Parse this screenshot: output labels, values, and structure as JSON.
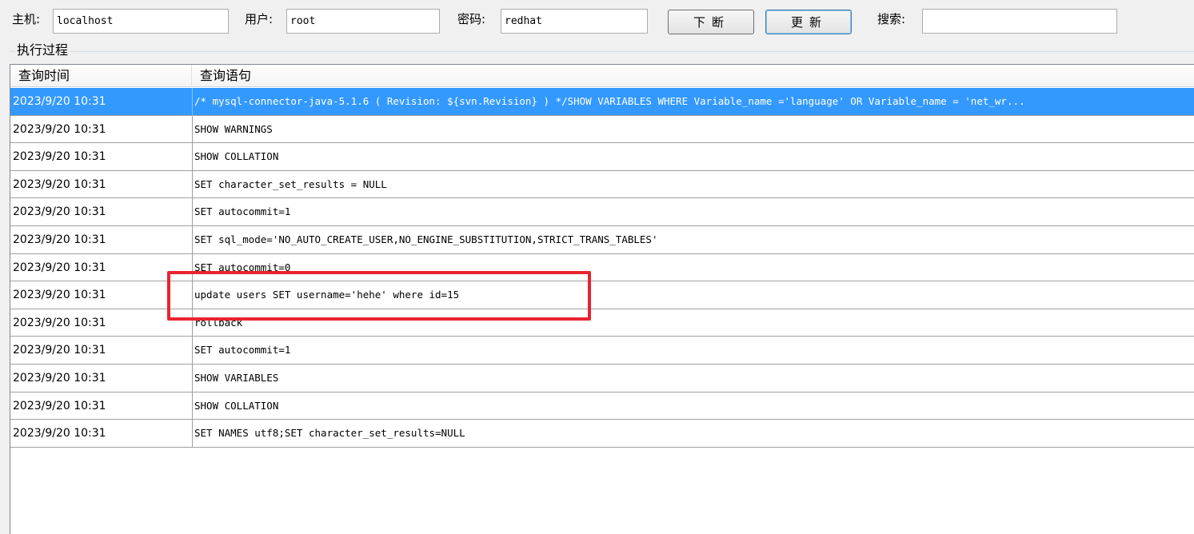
{
  "toolbar": {
    "host_label": "主机:",
    "host_value": "localhost",
    "user_label": "用户:",
    "user_value": "root",
    "password_label": "密码:",
    "password_value": "redhat",
    "interrupt_button": "下断",
    "refresh_button": "更新",
    "search_label": "搜索:",
    "search_value": ""
  },
  "group": {
    "title": "执行过程"
  },
  "table": {
    "columns": [
      "查询时间",
      "查询语句"
    ],
    "rows": [
      {
        "time": "2023/9/20 10:31",
        "sql": "/* mysql-connector-java-5.1.6 ( Revision: ${svn.Revision} ) */SHOW VARIABLES WHERE Variable_name ='language' OR Variable_name = 'net_wr...",
        "selected": true
      },
      {
        "time": "2023/9/20 10:31",
        "sql": "SHOW WARNINGS"
      },
      {
        "time": "2023/9/20 10:31",
        "sql": "SHOW COLLATION"
      },
      {
        "time": "2023/9/20 10:31",
        "sql": "SET character_set_results = NULL"
      },
      {
        "time": "2023/9/20 10:31",
        "sql": "SET autocommit=1"
      },
      {
        "time": "2023/9/20 10:31",
        "sql": "SET sql_mode='NO_AUTO_CREATE_USER,NO_ENGINE_SUBSTITUTION,STRICT_TRANS_TABLES'"
      },
      {
        "time": "2023/9/20 10:31",
        "sql": "SET autocommit=0"
      },
      {
        "time": "2023/9/20 10:31",
        "sql": "update users    SET username='hehe'   where id=15"
      },
      {
        "time": "2023/9/20 10:31",
        "sql": "rollback"
      },
      {
        "time": "2023/9/20 10:31",
        "sql": "SET autocommit=1"
      },
      {
        "time": "2023/9/20 10:31",
        "sql": "SHOW VARIABLES"
      },
      {
        "time": "2023/9/20 10:31",
        "sql": "SHOW COLLATION"
      },
      {
        "time": "2023/9/20 10:31",
        "sql": "SET NAMES utf8;SET character_set_results=NULL"
      }
    ]
  },
  "colors": {
    "selection": "#3399ff",
    "annotation": "#e8242f"
  }
}
